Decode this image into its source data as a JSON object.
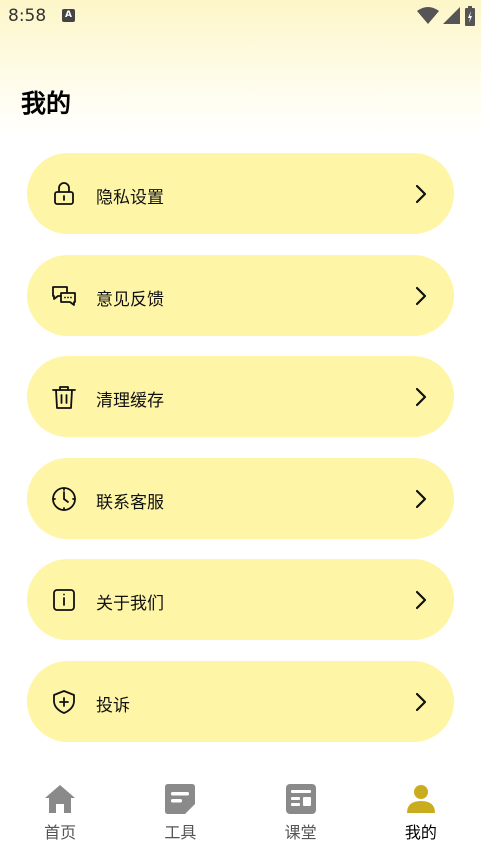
{
  "status_bar": {
    "time": "8:58",
    "notification_letter": "A"
  },
  "page": {
    "title": "我的"
  },
  "menu": {
    "items": [
      {
        "label": "隐私设置",
        "icon": "lock-icon"
      },
      {
        "label": "意见反馈",
        "icon": "chat-bubbles-icon"
      },
      {
        "label": "清理缓存",
        "icon": "trash-icon"
      },
      {
        "label": "联系客服",
        "icon": "clock-icon"
      },
      {
        "label": "关于我们",
        "icon": "info-icon"
      },
      {
        "label": "投诉",
        "icon": "shield-plus-icon"
      }
    ]
  },
  "tabbar": {
    "tabs": [
      {
        "label": "首页",
        "icon": "home-icon"
      },
      {
        "label": "工具",
        "icon": "tools-icon"
      },
      {
        "label": "课堂",
        "icon": "classroom-icon"
      },
      {
        "label": "我的",
        "icon": "person-icon",
        "active": true
      }
    ]
  },
  "colors": {
    "card": "#fef5a6",
    "accent": "#c9ad1e",
    "inactive_icon": "#8a8a8a"
  }
}
